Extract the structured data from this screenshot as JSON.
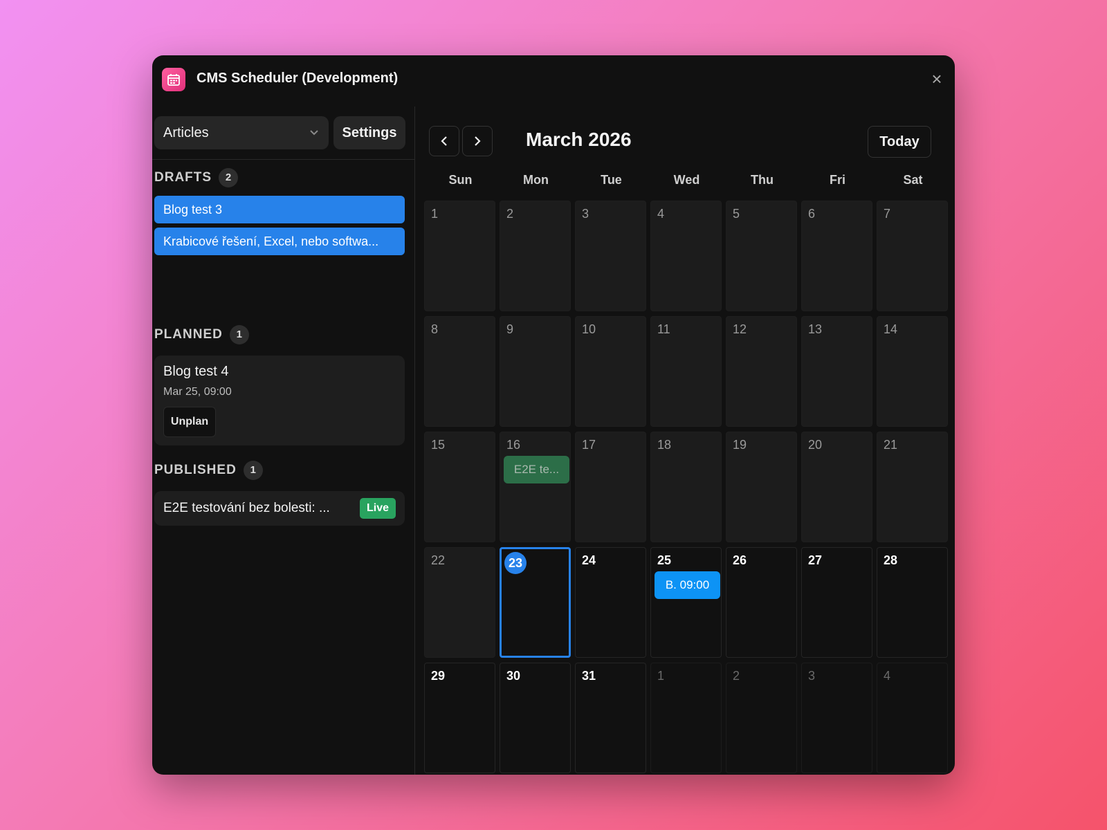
{
  "window": {
    "title": "CMS Scheduler (Development)",
    "close_glyph": "×"
  },
  "sidebar": {
    "collection": "Articles",
    "settings_label": "Settings",
    "drafts": {
      "label": "DRAFTS",
      "count": "2",
      "items": [
        "Blog test 3",
        "Krabicové řešení, Excel, nebo softwa..."
      ]
    },
    "planned": {
      "label": "PLANNED",
      "count": "1",
      "items": [
        {
          "title": "Blog test 4",
          "date": "Mar 25, 09:00",
          "action": "Unplan"
        }
      ]
    },
    "published": {
      "label": "PUBLISHED",
      "count": "1",
      "items": [
        {
          "title": "E2E testování bez bolesti: ...",
          "badge": "Live"
        }
      ]
    }
  },
  "calendar": {
    "month_title": "March 2026",
    "today_label": "Today",
    "weekdays": [
      "Sun",
      "Mon",
      "Tue",
      "Wed",
      "Thu",
      "Fri",
      "Sat"
    ],
    "days": [
      {
        "n": "1",
        "s": "past"
      },
      {
        "n": "2",
        "s": "past"
      },
      {
        "n": "3",
        "s": "past"
      },
      {
        "n": "4",
        "s": "past"
      },
      {
        "n": "5",
        "s": "past"
      },
      {
        "n": "6",
        "s": "past"
      },
      {
        "n": "7",
        "s": "past"
      },
      {
        "n": "8",
        "s": "past"
      },
      {
        "n": "9",
        "s": "past"
      },
      {
        "n": "10",
        "s": "past"
      },
      {
        "n": "11",
        "s": "past"
      },
      {
        "n": "12",
        "s": "past"
      },
      {
        "n": "13",
        "s": "past"
      },
      {
        "n": "14",
        "s": "past"
      },
      {
        "n": "15",
        "s": "past"
      },
      {
        "n": "16",
        "s": "past",
        "event": {
          "label": "E2E te...",
          "kind": "published"
        }
      },
      {
        "n": "17",
        "s": "past"
      },
      {
        "n": "18",
        "s": "past"
      },
      {
        "n": "19",
        "s": "past"
      },
      {
        "n": "20",
        "s": "past"
      },
      {
        "n": "21",
        "s": "past"
      },
      {
        "n": "22",
        "s": "past"
      },
      {
        "n": "23",
        "s": "today"
      },
      {
        "n": "24",
        "s": "future"
      },
      {
        "n": "25",
        "s": "future",
        "event": {
          "label": "B.  09:00",
          "kind": "planned"
        }
      },
      {
        "n": "26",
        "s": "future"
      },
      {
        "n": "27",
        "s": "future"
      },
      {
        "n": "28",
        "s": "future"
      },
      {
        "n": "29",
        "s": "future"
      },
      {
        "n": "30",
        "s": "future"
      },
      {
        "n": "31",
        "s": "future"
      },
      {
        "n": "1",
        "s": "other"
      },
      {
        "n": "2",
        "s": "other"
      },
      {
        "n": "3",
        "s": "other"
      },
      {
        "n": "4",
        "s": "other"
      }
    ]
  },
  "colors": {
    "accent": "#2782ea",
    "live": "#29a35f",
    "planned_event": "#0d93f5",
    "published_event": "#2c6e48"
  },
  "icons": {
    "app": "calendar-icon",
    "prev": "chevron-left-icon",
    "next": "chevron-right-icon",
    "select": "chevron-down-icon",
    "close": "close-icon"
  }
}
